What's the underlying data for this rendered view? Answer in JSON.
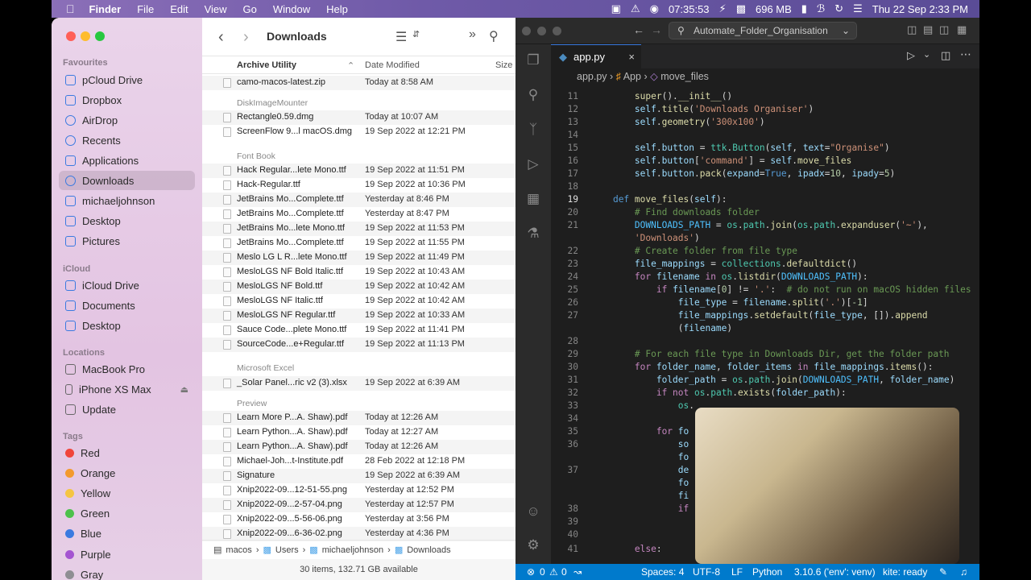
{
  "menubar": {
    "app": "Finder",
    "items": [
      "File",
      "Edit",
      "View",
      "Go",
      "Window",
      "Help"
    ],
    "time_counter": "07:35:53",
    "memory": "696 MB",
    "datetime": "Thu 22 Sep  2:33 PM"
  },
  "finder": {
    "title": "Downloads",
    "sidebar": {
      "favourites_head": "Favourites",
      "favourites": [
        "pCloud Drive",
        "Dropbox",
        "AirDrop",
        "Recents",
        "Applications",
        "Downloads",
        "michaeljohnson",
        "Desktop",
        "Pictures"
      ],
      "icloud_head": "iCloud",
      "icloud": [
        "iCloud Drive",
        "Documents",
        "Desktop"
      ],
      "locations_head": "Locations",
      "locations": [
        "MacBook Pro",
        "iPhone XS Max",
        "Update"
      ],
      "tags_head": "Tags",
      "tags": [
        {
          "name": "Red",
          "color": "#f0453a"
        },
        {
          "name": "Orange",
          "color": "#f39a2d"
        },
        {
          "name": "Yellow",
          "color": "#f5c542"
        },
        {
          "name": "Green",
          "color": "#4cc14b"
        },
        {
          "name": "Blue",
          "color": "#3a7ae0"
        },
        {
          "name": "Purple",
          "color": "#a455d1"
        },
        {
          "name": "Gray",
          "color": "#8e8e93"
        }
      ]
    },
    "columns": {
      "name": "Archive Utility",
      "date": "Date Modified",
      "size": "Size"
    },
    "groups": {
      "g1": "DiskImageMounter",
      "g2": "Font Book",
      "g3": "Microsoft Excel",
      "g4": "Preview"
    },
    "files": [
      {
        "name": "camo-macos-latest.zip",
        "date": "Today at 8:58 AM"
      },
      {
        "name": "Rectangle0.59.dmg",
        "date": "Today at 10:07 AM"
      },
      {
        "name": "ScreenFlow 9...l macOS.dmg",
        "date": "19 Sep 2022 at 12:21 PM"
      },
      {
        "name": "Hack Regular...lete Mono.ttf",
        "date": "19 Sep 2022 at 11:51 PM"
      },
      {
        "name": "Hack-Regular.ttf",
        "date": "19 Sep 2022 at 10:36 PM"
      },
      {
        "name": "JetBrains Mo...Complete.ttf",
        "date": "Yesterday at 8:46 PM"
      },
      {
        "name": "JetBrains Mo...Complete.ttf",
        "date": "Yesterday at 8:47 PM"
      },
      {
        "name": "JetBrains Mo...lete Mono.ttf",
        "date": "19 Sep 2022 at 11:53 PM"
      },
      {
        "name": "JetBrains Mo...Complete.ttf",
        "date": "19 Sep 2022 at 11:55 PM"
      },
      {
        "name": "Meslo LG L R...lete Mono.ttf",
        "date": "19 Sep 2022 at 11:49 PM"
      },
      {
        "name": "MesloLGS NF Bold Italic.ttf",
        "date": "19 Sep 2022 at 10:43 AM"
      },
      {
        "name": "MesloLGS NF Bold.ttf",
        "date": "19 Sep 2022 at 10:42 AM"
      },
      {
        "name": "MesloLGS NF Italic.ttf",
        "date": "19 Sep 2022 at 10:42 AM"
      },
      {
        "name": "MesloLGS NF Regular.ttf",
        "date": "19 Sep 2022 at 10:33 AM"
      },
      {
        "name": "Sauce Code...plete Mono.ttf",
        "date": "19 Sep 2022 at 11:41 PM"
      },
      {
        "name": "SourceCode...e+Regular.ttf",
        "date": "19 Sep 2022 at 11:13 PM"
      },
      {
        "name": "_Solar Panel...ric v2 (3).xlsx",
        "date": "19 Sep 2022 at 6:39 AM"
      },
      {
        "name": "Learn More P...A. Shaw).pdf",
        "date": "Today at 12:26 AM"
      },
      {
        "name": "Learn Python...A. Shaw).pdf",
        "date": "Today at 12:27 AM"
      },
      {
        "name": "Learn Python...A. Shaw).pdf",
        "date": "Today at 12:26 AM"
      },
      {
        "name": "Michael-Joh...t-Institute.pdf",
        "date": "28 Feb 2022 at 12:18 PM"
      },
      {
        "name": "Signature",
        "date": "19 Sep 2022 at 6:39 AM"
      },
      {
        "name": "Xnip2022-09...12-51-55.png",
        "date": "Yesterday at 12:52 PM"
      },
      {
        "name": "Xnip2022-09...2-57-04.png",
        "date": "Yesterday at 12:57 PM"
      },
      {
        "name": "Xnip2022-09...5-56-06.png",
        "date": "Yesterday at 3:56 PM"
      },
      {
        "name": "Xnip2022-09...6-36-02.png",
        "date": "Yesterday at 4:36 PM"
      }
    ],
    "path": [
      "macos",
      "Users",
      "michaeljohnson",
      "Downloads"
    ],
    "status": "30 items, 132.71 GB available"
  },
  "vscode": {
    "search": "Automate_Folder_Organisation",
    "tab": "app.py",
    "breadcrumb": [
      "app.py",
      "App",
      "move_files"
    ],
    "status": {
      "errors": "0",
      "warnings": "0",
      "spaces": "Spaces: 4",
      "encoding": "UTF-8",
      "eol": "LF",
      "lang": "Python",
      "interpreter": "3.10.6 ('env': venv)",
      "kite": "kite: ready"
    }
  }
}
